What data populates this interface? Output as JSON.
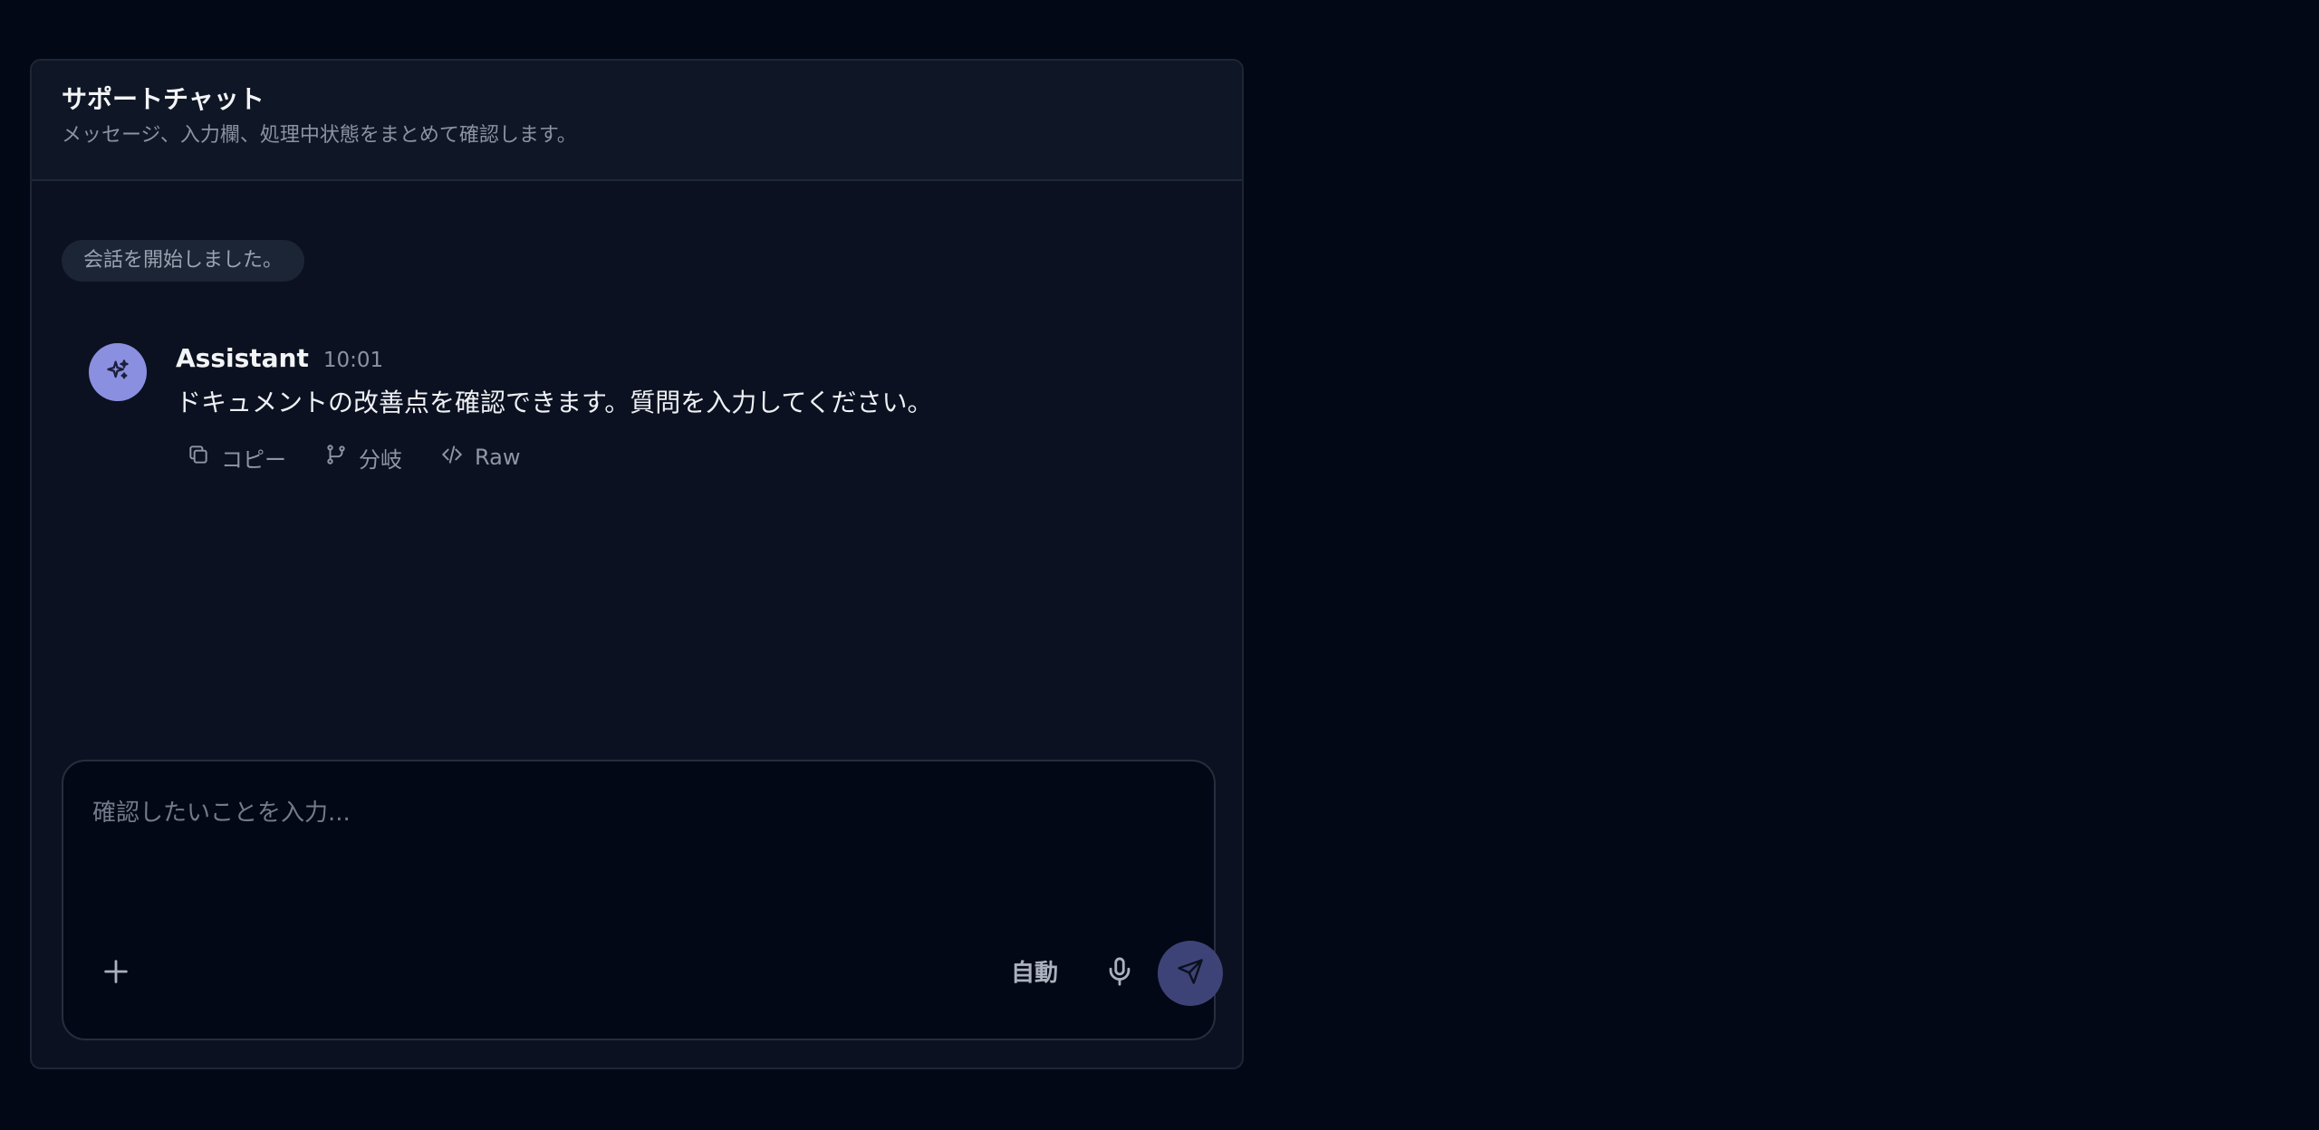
{
  "header": {
    "title": "サポートチャット",
    "subtitle": "メッセージ、入力欄、処理中状態をまとめて確認します。"
  },
  "system_notice": "会話を開始しました。",
  "message": {
    "author": "Assistant",
    "time": "10:01",
    "text": "ドキュメントの改善点を確認できます。質問を入力してください。",
    "avatar_icon": "sparkles-icon",
    "actions": [
      {
        "label": "コピー",
        "icon": "copy-icon"
      },
      {
        "label": "分岐",
        "icon": "branch-icon"
      },
      {
        "label": "Raw",
        "icon": "code-icon"
      }
    ]
  },
  "composer": {
    "placeholder": "確認したいことを入力...",
    "value": "",
    "mode_label": "自動",
    "add_icon": "plus-icon",
    "mic_icon": "microphone-icon",
    "send_icon": "send-icon"
  },
  "colors": {
    "page_background": "#030816",
    "panel_background": "#0b1120",
    "avatar": "#8b8fe0",
    "send_button": "#3e4377"
  }
}
